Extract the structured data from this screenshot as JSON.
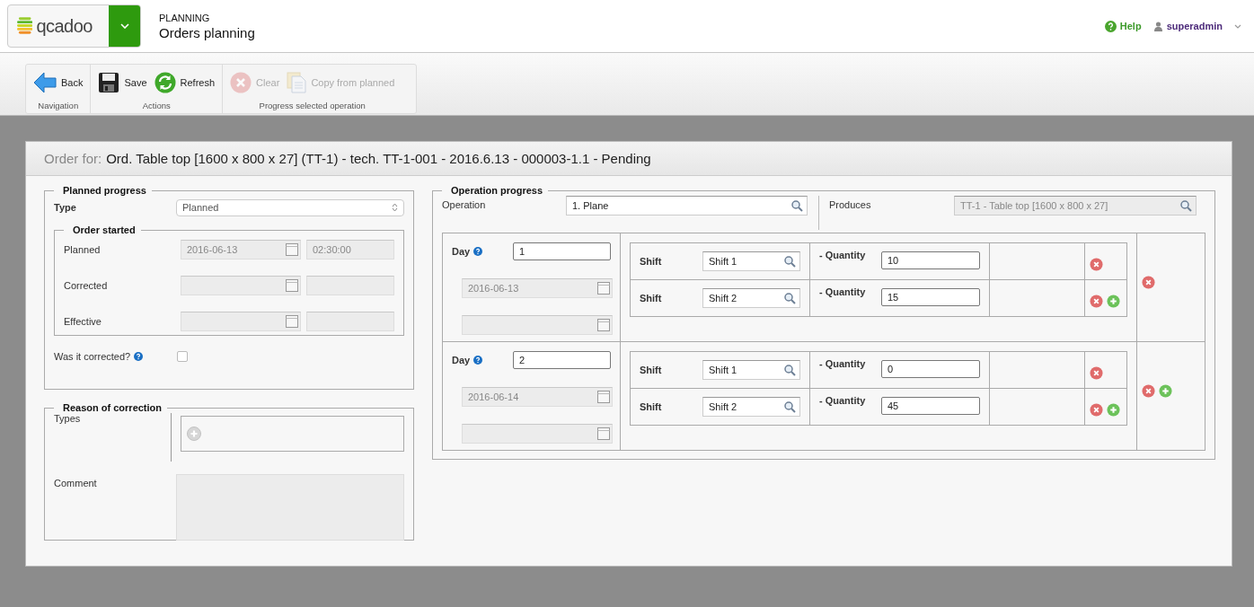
{
  "header": {
    "logo": "qcadoo",
    "module": "PLANNING",
    "title": "Orders planning",
    "help": "Help",
    "user": "superadmin"
  },
  "toolbar": [
    {
      "label": "Navigation",
      "buttons": [
        {
          "label": "Back",
          "kind": "back",
          "disabled": false
        }
      ]
    },
    {
      "label": "Actions",
      "buttons": [
        {
          "label": "Save",
          "kind": "save",
          "disabled": false
        },
        {
          "label": "Refresh",
          "kind": "refresh",
          "disabled": false
        }
      ]
    },
    {
      "label": "Progress selected operation",
      "buttons": [
        {
          "label": "Clear",
          "kind": "clear",
          "disabled": true
        },
        {
          "label": "Copy from planned",
          "kind": "copy",
          "disabled": true
        }
      ]
    }
  ],
  "order": {
    "prefix": "Order for:",
    "title": "Ord. Table top [1600 x 800 x 27] (TT-1) - tech. TT-1-001 - 2016.6.13 - 000003-1.1 - Pending"
  },
  "planned_progress": {
    "legend": "Planned progress",
    "type_label": "Type",
    "type_value": "Planned",
    "order_started": {
      "legend": "Order started",
      "rows": [
        {
          "label": "Planned",
          "date": "2016-06-13",
          "time": "02:30:00"
        },
        {
          "label": "Corrected",
          "date": "",
          "time": ""
        },
        {
          "label": "Effective",
          "date": "",
          "time": ""
        }
      ]
    },
    "was_corrected": {
      "label": "Was it corrected?",
      "checked": false
    }
  },
  "reason": {
    "legend": "Reason of correction",
    "types_label": "Types",
    "comment_label": "Comment"
  },
  "operation_progress": {
    "legend": "Operation progress",
    "operation_label": "Operation",
    "operation_value": "1.  Plane",
    "produces_label": "Produces",
    "produces_value": "TT-1 - Table top [1600 x 800 x 27]",
    "days": [
      {
        "label": "Day",
        "value": "1",
        "date": "2016-06-13",
        "add": false,
        "shifts": [
          {
            "label": "Shift",
            "shift": "Shift 1",
            "quantity_label": "- Quantity",
            "quantity": "10",
            "add": false
          },
          {
            "label": "Shift",
            "shift": "Shift 2",
            "quantity_label": "- Quantity",
            "quantity": "15",
            "add": true
          }
        ]
      },
      {
        "label": "Day",
        "value": "2",
        "date": "2016-06-14",
        "add": true,
        "shifts": [
          {
            "label": "Shift",
            "shift": "Shift 1",
            "quantity_label": "- Quantity",
            "quantity": "0",
            "add": false
          },
          {
            "label": "Shift",
            "shift": "Shift 2",
            "quantity_label": "- Quantity",
            "quantity": "45",
            "add": true
          }
        ]
      }
    ]
  }
}
